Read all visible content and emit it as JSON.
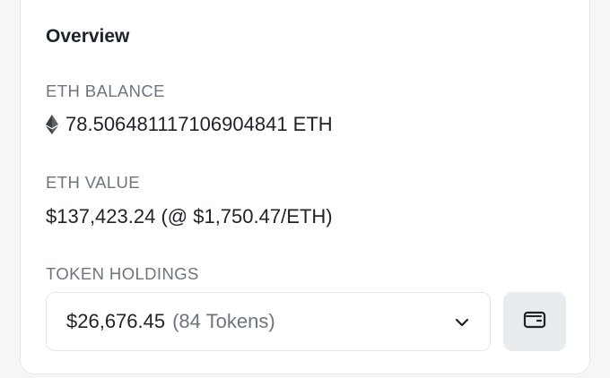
{
  "overview": {
    "title": "Overview",
    "eth_balance": {
      "label": "ETH BALANCE",
      "value": "78.506481117106904841 ETH",
      "icon": "ethereum-icon"
    },
    "eth_value": {
      "label": "ETH VALUE",
      "value": "$137,423.24 (@ $1,750.47/ETH)"
    },
    "token_holdings": {
      "label": "TOKEN HOLDINGS",
      "amount": "$26,676.45",
      "count": "(84 Tokens)",
      "dropdown_icon": "chevron-down-icon",
      "wallet_icon": "wallet-icon"
    }
  },
  "colors": {
    "text_primary": "#1e2329",
    "text_secondary": "#6c757d",
    "border": "#e3e6ea",
    "button_bg": "#e9ecef"
  }
}
